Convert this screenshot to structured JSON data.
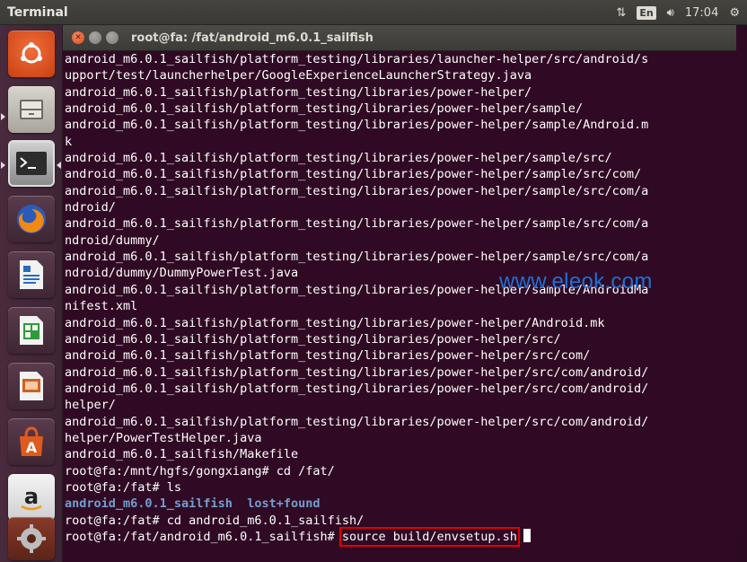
{
  "top_panel": {
    "app_title": "Terminal",
    "keyboard_layout": "En",
    "time": "17:04",
    "icons": [
      "network-icon",
      "volume-icon",
      "settings-icon"
    ]
  },
  "launcher": {
    "items": [
      {
        "name": "dash-home-icon",
        "color": "#dd4814"
      },
      {
        "name": "files-icon",
        "color": "#b8b5ae"
      },
      {
        "name": "terminal-icon",
        "color": "#4a4a4a"
      },
      {
        "name": "firefox-icon",
        "color": "#e66000"
      },
      {
        "name": "writer-icon",
        "color": "#2a6ac0"
      },
      {
        "name": "calc-icon",
        "color": "#2f9a3c"
      },
      {
        "name": "impress-icon",
        "color": "#d0601e"
      },
      {
        "name": "software-center-icon",
        "color": "#e05a1c"
      },
      {
        "name": "amazon-icon",
        "color": "#e8e8e8"
      },
      {
        "name": "system-settings-icon",
        "color": "#9a3a2a"
      }
    ]
  },
  "window": {
    "title": "root@fa: /fat/android_m6.0.1_sailfish"
  },
  "terminal": {
    "lines": [
      "android_m6.0.1_sailfish/platform_testing/libraries/launcher-helper/src/android/s",
      "upport/test/launcherhelper/GoogleExperienceLauncherStrategy.java",
      "android_m6.0.1_sailfish/platform_testing/libraries/power-helper/",
      "android_m6.0.1_sailfish/platform_testing/libraries/power-helper/sample/",
      "android_m6.0.1_sailfish/platform_testing/libraries/power-helper/sample/Android.m",
      "k",
      "android_m6.0.1_sailfish/platform_testing/libraries/power-helper/sample/src/",
      "android_m6.0.1_sailfish/platform_testing/libraries/power-helper/sample/src/com/",
      "android_m6.0.1_sailfish/platform_testing/libraries/power-helper/sample/src/com/a",
      "ndroid/",
      "android_m6.0.1_sailfish/platform_testing/libraries/power-helper/sample/src/com/a",
      "ndroid/dummy/",
      "android_m6.0.1_sailfish/platform_testing/libraries/power-helper/sample/src/com/a",
      "ndroid/dummy/DummyPowerTest.java",
      "android_m6.0.1_sailfish/platform_testing/libraries/power-helper/sample/AndroidMa",
      "nifest.xml",
      "android_m6.0.1_sailfish/platform_testing/libraries/power-helper/Android.mk",
      "android_m6.0.1_sailfish/platform_testing/libraries/power-helper/src/",
      "android_m6.0.1_sailfish/platform_testing/libraries/power-helper/src/com/",
      "android_m6.0.1_sailfish/platform_testing/libraries/power-helper/src/com/android/",
      "android_m6.0.1_sailfish/platform_testing/libraries/power-helper/src/com/android/",
      "helper/",
      "android_m6.0.1_sailfish/platform_testing/libraries/power-helper/src/com/android/",
      "helper/PowerTestHelper.java",
      "android_m6.0.1_sailfish/Makefile",
      "root@fa:/mnt/hgfs/gongxiang# cd /fat/",
      "root@fa:/fat# ls"
    ],
    "ls_output": {
      "dir1": "android_m6.0.1_sailfish",
      "dir2": "lost+found"
    },
    "cd_line": "root@fa:/fat# cd android_m6.0.1_sailfish/",
    "prompt": "root@fa:/fat/android_m6.0.1_sailfish#",
    "current_command": "source build/envsetup.sh"
  },
  "watermark": "www.eleok.com",
  "colors": {
    "terminal_bg": "#300a24",
    "directory": "#729fcf",
    "highlight_box": "#e00000"
  }
}
